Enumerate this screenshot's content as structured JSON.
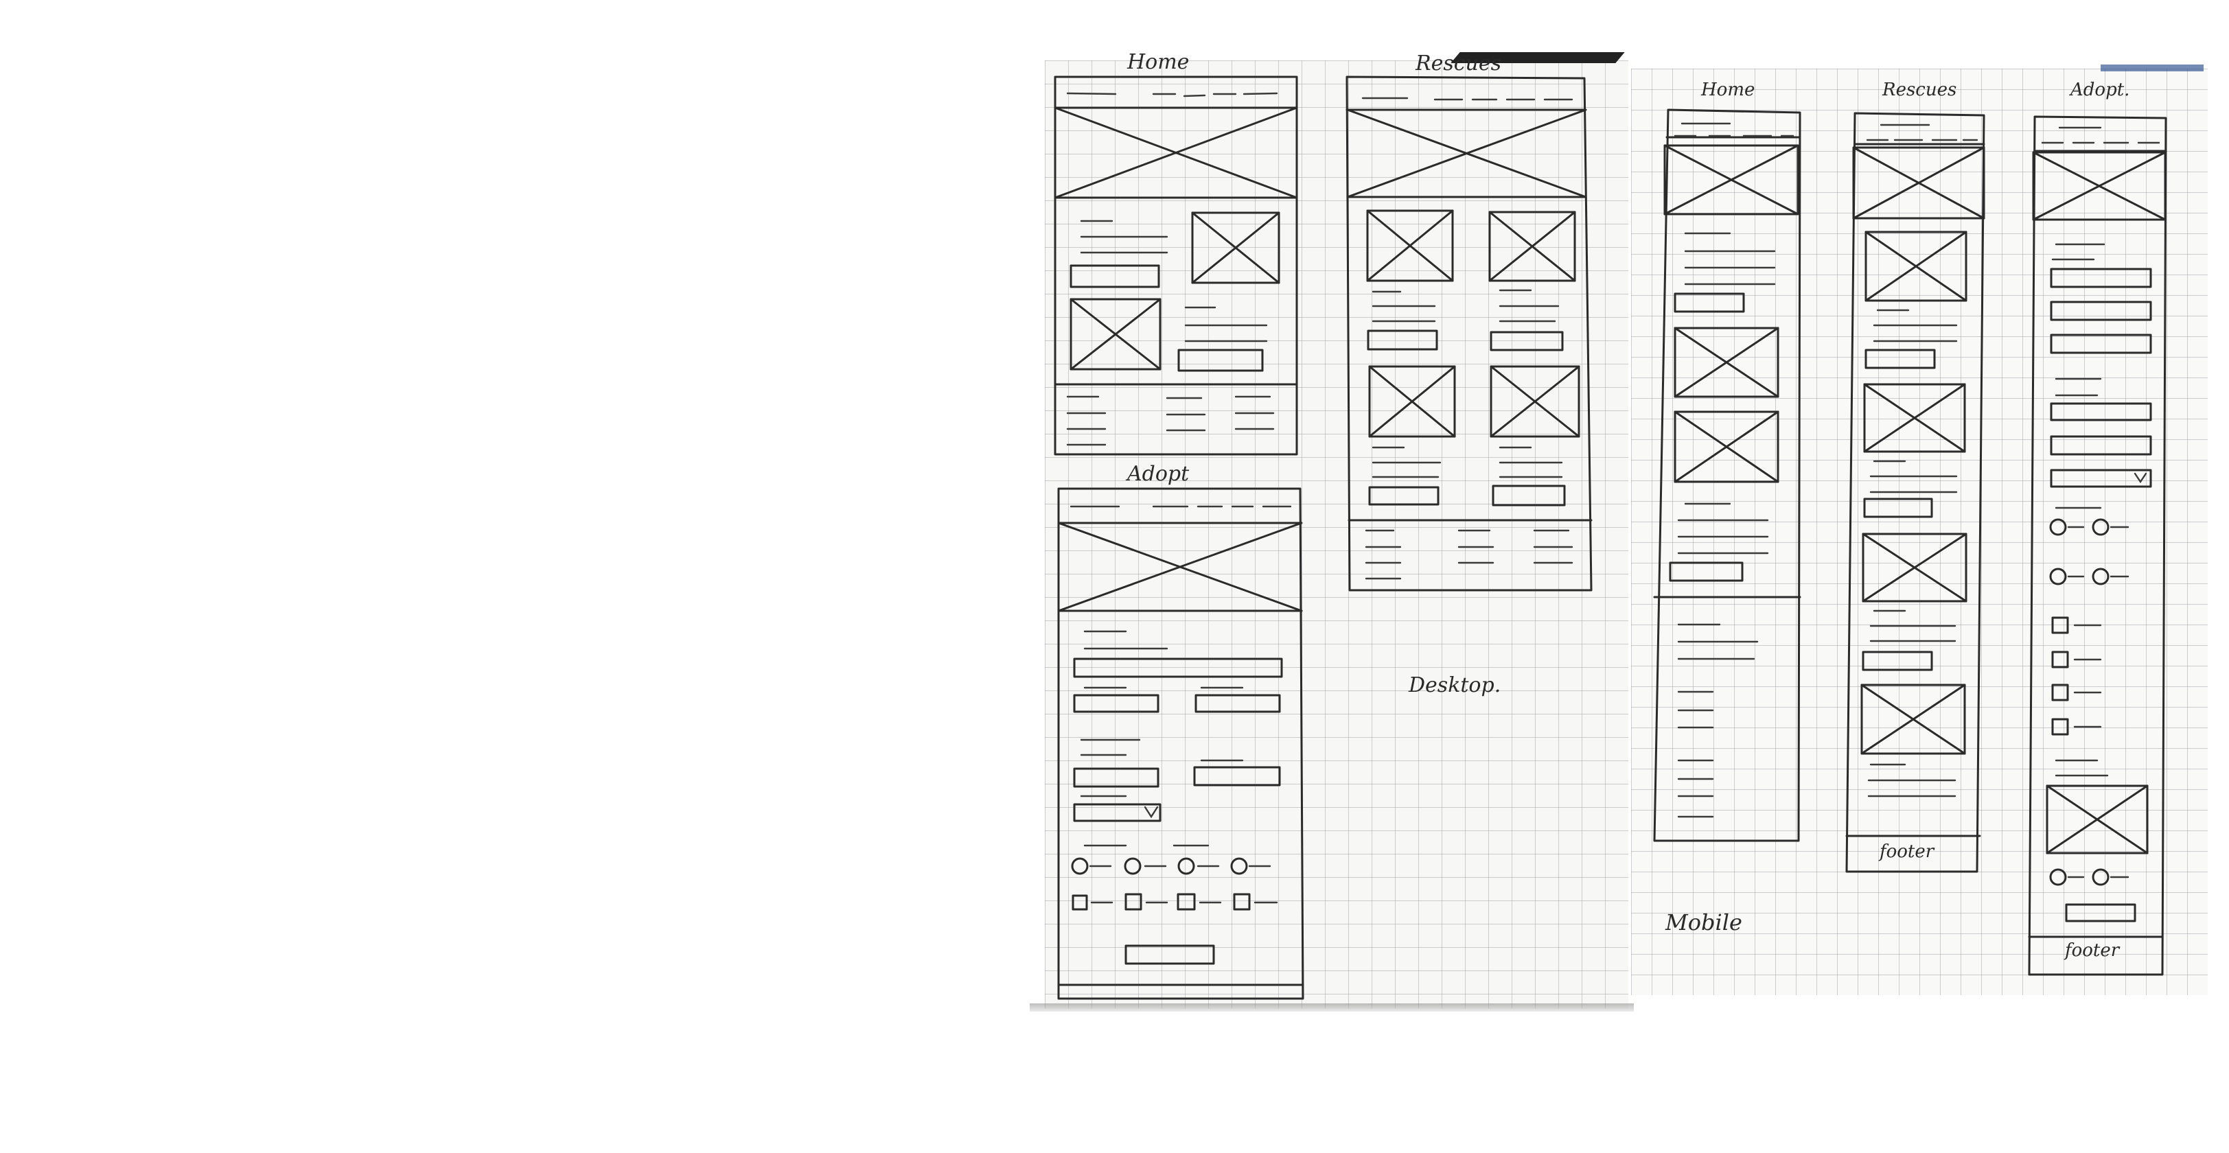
{
  "labels": {
    "desktop_home": "Home",
    "desktop_rescues": "Rescues",
    "desktop_adopt": "Adopt",
    "desktop": "Desktop.",
    "mobile_home": "Home",
    "mobile_rescues": "Rescues",
    "mobile_adopt": "Adopt.",
    "mobile": "Mobile",
    "footer_rescues": "footer",
    "footer_adopt": "footer"
  },
  "colors": {
    "ink": "#2b2b2b",
    "paper": "#f7f7f6",
    "grid": "#9696a0"
  }
}
